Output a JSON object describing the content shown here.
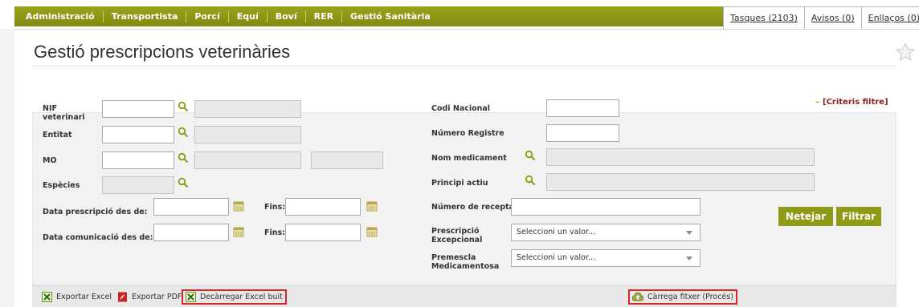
{
  "nav": {
    "items": [
      "Administració",
      "Transportista",
      "Porcí",
      "Equí",
      "Boví",
      "RER",
      "Gestió Sanitària"
    ],
    "links": [
      "Tasques (2103)",
      "Avisos (0)",
      "Enllaços (0)"
    ]
  },
  "page": {
    "title": "Gestió prescripcions veterinàries",
    "criteria_link": "[Criteris filtre]",
    "criteria_dash": "–"
  },
  "form": {
    "nif_label": "NIF veterinari",
    "entitat_label": "Entitat",
    "mo_label": "MO",
    "especies_label": "Espècies",
    "data_prescripcio_label": "Data prescripció des de:",
    "data_comunicacio_label": "Data comunicació des de:",
    "fins_label": "Fins:",
    "codi_nacional_label": "Codi Nacional",
    "numero_registre_label": "Número Registre",
    "nom_medicament_label": "Nom medicament",
    "principi_actiu_label": "Principi actiu",
    "numero_recepta_label": "Número de recepta",
    "prescripcio_excepcional_label": "Prescripció Excepcional",
    "premescla_label": "Premescla Medicamentosa",
    "select_placeholder": "Seleccioni un valor..."
  },
  "buttons": {
    "netejar": "Netejar",
    "filtrar": "Filtrar"
  },
  "bottom": {
    "export_excel": "Exportar Excel",
    "export_pdf": "Exportar PDF",
    "download_excel": "Decàrregar Excel buit",
    "upload": "Càrrega fitxer (Procés)"
  },
  "colors": {
    "accent": "#8f9a17",
    "highlight": "#d9262b",
    "criteria": "#8b1d1d"
  }
}
